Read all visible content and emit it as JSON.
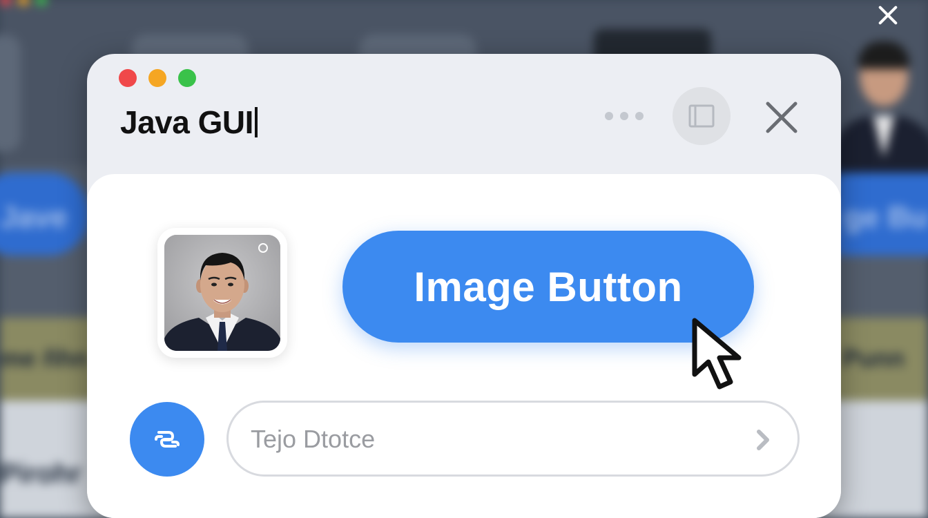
{
  "window": {
    "title": "Java GUI",
    "controls": {
      "close": "red",
      "minimize": "yellow",
      "zoom": "green"
    },
    "more_icon": "more-horizontal-icon",
    "panel_icon": "sidebar-panel-icon",
    "close_icon": "close-icon"
  },
  "main": {
    "avatar": {
      "icon": "profile-photo",
      "radio_icon": "radio-circle-icon"
    },
    "image_button": {
      "label": "Image Button",
      "color": "#3c8af0"
    },
    "action_button": {
      "icon": "link-icon"
    },
    "text_field": {
      "placeholder": "Tejo Dtotce",
      "value": "",
      "arrow_icon": "chevron-right-icon"
    }
  },
  "background": {
    "left_pill_text": "Jave",
    "left_strip_text": "me ñhn",
    "left_bottom_text": "Pirohr",
    "right_pill_text": "ge Bu",
    "right_strip_text": "Punn",
    "close_icon": "close-icon"
  },
  "colors": {
    "accent": "#3c8af0",
    "window_bg": "#eceef3",
    "content_bg": "#ffffff"
  }
}
